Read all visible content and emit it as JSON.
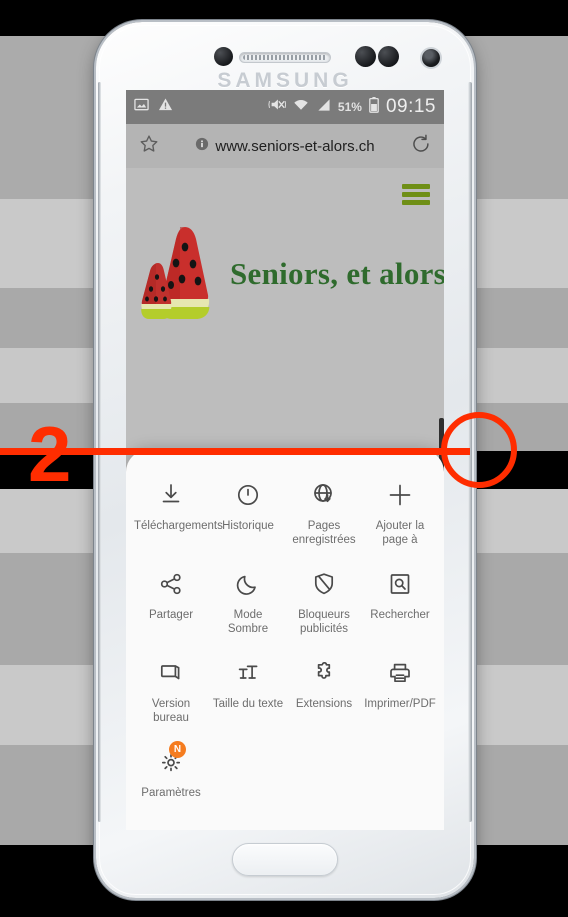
{
  "annotation": {
    "step_number": "2",
    "accent_color": "#ff2d00",
    "target": "Ajouter la page à"
  },
  "device": {
    "brand": "SAMSUNG",
    "speaker": "speaker-grille",
    "home_button": "home-button"
  },
  "statusbar": {
    "icons_left": [
      "image-icon",
      "warning-icon"
    ],
    "icons_right": [
      "mute-vibrate-icon",
      "wifi-icon",
      "signal-icon",
      "battery-icon"
    ],
    "battery": "51%",
    "clock": "09:15"
  },
  "urlbar": {
    "bookmark_icon": "star-icon",
    "info_icon": "info-icon",
    "url": "www.seniors-et-alors.ch",
    "reload_icon": "reload-icon"
  },
  "webpage": {
    "menu_icon": "hamburger-icon",
    "menu_color": "#6f8f16",
    "logo": "watermelon-logo",
    "title": "Seniors, et alors...",
    "title_color": "#2f6b2d",
    "background_color": "#bdbdbd"
  },
  "menu_sheet": {
    "background_color": "#fafafa",
    "items": [
      {
        "label": "Téléchargements",
        "icon": "download-icon",
        "badge": null
      },
      {
        "label": "Historique",
        "icon": "history-clock-icon",
        "badge": null
      },
      {
        "label": "Pages enregistrées",
        "icon": "globe-download-icon",
        "badge": null
      },
      {
        "label": "Ajouter la page à",
        "icon": "plus-icon",
        "badge": null
      },
      {
        "label": "Partager",
        "icon": "share-icon",
        "badge": null
      },
      {
        "label": "Mode Sombre",
        "icon": "moon-icon",
        "badge": null
      },
      {
        "label": "Bloqueurs publicités",
        "icon": "shield-block-icon",
        "badge": null
      },
      {
        "label": "Rechercher",
        "icon": "find-in-page-icon",
        "badge": null
      },
      {
        "label": "Version bureau",
        "icon": "desktop-icon",
        "badge": null
      },
      {
        "label": "Taille du texte",
        "icon": "text-size-icon",
        "badge": null
      },
      {
        "label": "Extensions",
        "icon": "puzzle-icon",
        "badge": null
      },
      {
        "label": "Imprimer/PDF",
        "icon": "printer-icon",
        "badge": null
      },
      {
        "label": "Paramètres",
        "icon": "gear-icon",
        "badge": "N"
      }
    ]
  }
}
